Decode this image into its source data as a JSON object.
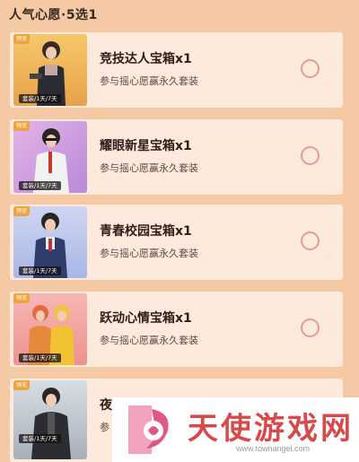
{
  "header": {
    "title": "人气心愿·5选1"
  },
  "items": [
    {
      "name": "竞技达人宝箱x1",
      "desc": "参与摇心愿赢永久套装",
      "badge": "预览",
      "duration": "套装/1天/7天",
      "selected": false
    },
    {
      "name": "耀眼新星宝箱x1",
      "desc": "参与摇心愿赢永久套装",
      "badge": "预览",
      "duration": "套装/1天/7天",
      "selected": false
    },
    {
      "name": "青春校园宝箱x1",
      "desc": "参与摇心愿赢永久套装",
      "badge": "预览",
      "duration": "套装/1天/7天",
      "selected": false
    },
    {
      "name": "跃动心情宝箱x1",
      "desc": "参与摇心愿赢永久套装",
      "badge": "预览",
      "duration": "套装/1天/7天",
      "selected": false
    },
    {
      "name": "夜",
      "desc": "参",
      "badge": "预览",
      "duration": "套装/1天/7天",
      "selected": false
    }
  ],
  "watermark": {
    "brand": "天使游戏网",
    "url": "www.townangel.com"
  },
  "colors": {
    "background": "#f4c9a4",
    "card": "#fdeadd",
    "radio_border": "#e19c8c",
    "watermark_red": "#d84a4a"
  }
}
